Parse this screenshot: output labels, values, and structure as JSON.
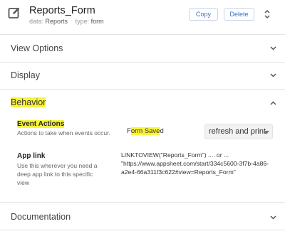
{
  "header": {
    "title": "Reports_Form",
    "data_label": "data:",
    "data_value": "Reports",
    "type_label": "type:",
    "type_value": "form",
    "copy_label": "Copy",
    "delete_label": "Delete",
    "edit_icon": "pencil-square-icon",
    "sort_icon": "up-down-arrows-icon"
  },
  "sections": {
    "view_options": "View Options",
    "display": "Display",
    "behavior": "Behavior",
    "documentation": "Documentation"
  },
  "behavior": {
    "event_actions": {
      "title": "Event Actions",
      "description": "Actions to take when events occur.",
      "event_prefix": "F",
      "event_highlight": "orm Save",
      "event_suffix": "d",
      "selected_action": "refresh and print"
    },
    "app_link": {
      "title": "App link",
      "description": "Use this wherever you need a deep app link to this specific view",
      "value": "LINKTOVIEW(\"Reports_Form\") .... or ... \"https://www.appsheet.com/start/334c5600-3f7b-4a86-a2e4-66a311f3c622#view=Reports_Form\""
    }
  },
  "colors": {
    "highlight": "#f9f53a",
    "accent_blue": "#3b6fc9"
  }
}
